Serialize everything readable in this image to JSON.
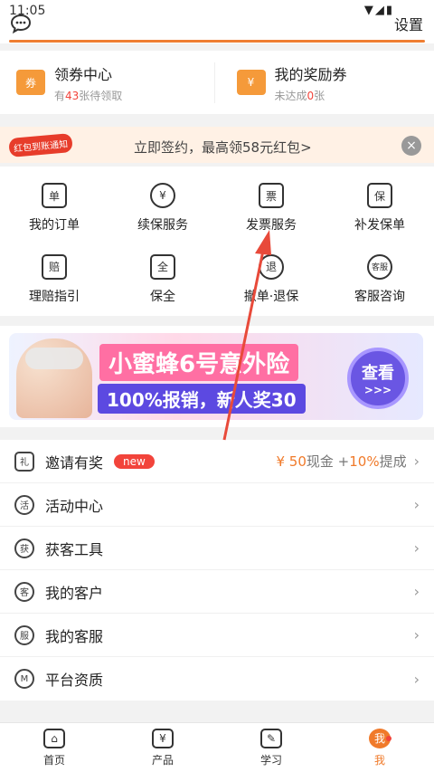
{
  "status": {
    "time": "11:05",
    "sys": "▼◢▮"
  },
  "header": {
    "settings_label": "设置"
  },
  "coupons": [
    {
      "icon": "券",
      "title": "领券中心",
      "sub_prefix": "有",
      "sub_value": "43",
      "sub_suffix": "张待领取"
    },
    {
      "icon": "¥",
      "title": "我的奖励券",
      "sub_prefix": "未达成",
      "sub_value": "0",
      "sub_suffix": "张"
    }
  ],
  "notice": {
    "badge": "红包到账通知",
    "text": "立即签约，最高领58元红包>",
    "close": "×"
  },
  "grid": [
    {
      "icon": "单",
      "label": "我的订单"
    },
    {
      "icon": "¥",
      "label": "续保服务"
    },
    {
      "icon": "票",
      "label": "发票服务"
    },
    {
      "icon": "保",
      "label": "补发保单"
    },
    {
      "icon": "赔",
      "label": "理赔指引"
    },
    {
      "icon": "全",
      "label": "保全"
    },
    {
      "icon": "退",
      "label": "撤单·退保"
    },
    {
      "icon": "客服",
      "label": "客服咨询"
    }
  ],
  "ad": {
    "line1": "小蜜蜂6号意外险",
    "line2": "100%报销，新人奖30",
    "btn": "查看",
    "btn_sub": ">>>"
  },
  "list": [
    {
      "icon": "礼",
      "label": "邀请有奖",
      "badge": "new",
      "right_amount": "¥ 50",
      "right_mid": " 现金 + ",
      "right_pct": "10%",
      "right_suffix": "提成"
    },
    {
      "icon": "活",
      "label": "活动中心"
    },
    {
      "icon": "获",
      "label": "获客工具"
    },
    {
      "icon": "客",
      "label": "我的客户"
    },
    {
      "icon": "服",
      "label": "我的客服"
    },
    {
      "icon": "M",
      "label": "平台资质"
    }
  ],
  "tabs": [
    {
      "icon": "⌂",
      "label": "首页"
    },
    {
      "icon": "¥",
      "label": "产品"
    },
    {
      "icon": "✎",
      "label": "学习"
    },
    {
      "icon": "我",
      "label": "我",
      "active": true
    }
  ],
  "colors": {
    "accent": "#f07a2a",
    "red": "#f2443b",
    "annotation_arrow": "#e84a3a"
  }
}
